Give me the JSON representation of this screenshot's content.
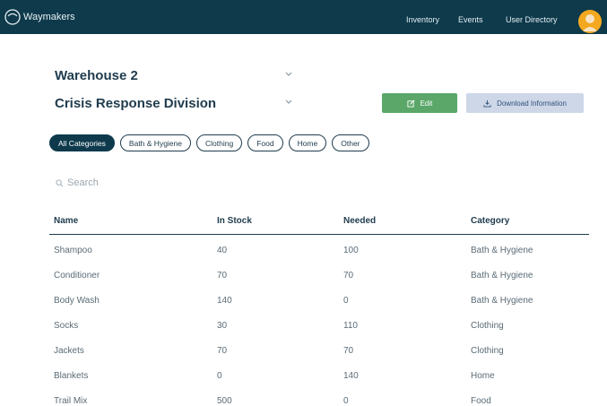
{
  "header": {
    "brand": "Waymakers",
    "nav": [
      "Inventory",
      "Events",
      "User Directory"
    ]
  },
  "selectors": {
    "warehouse": "Warehouse 2",
    "division": "Crisis Response Division"
  },
  "actions": {
    "edit_label": "Edit",
    "download_label": "Download Information"
  },
  "categories": [
    "All Categories",
    "Bath & Hygiene",
    "Clothing",
    "Food",
    "Home",
    "Other"
  ],
  "search": {
    "placeholder": "Search"
  },
  "table": {
    "columns": [
      "Name",
      "In Stock",
      "Needed",
      "Category"
    ],
    "rows": [
      [
        "Shampoo",
        "40",
        "100",
        "Bath & Hygiene"
      ],
      [
        "Conditioner",
        "70",
        "70",
        "Bath & Hygiene"
      ],
      [
        "Body Wash",
        "140",
        "0",
        "Bath & Hygiene"
      ],
      [
        "Socks",
        "30",
        "110",
        "Clothing"
      ],
      [
        "Jackets",
        "70",
        "70",
        "Clothing"
      ],
      [
        "Blankets",
        "0",
        "140",
        "Home"
      ],
      [
        "Trail Mix",
        "500",
        "0",
        "Food"
      ]
    ]
  },
  "colors": {
    "nav_bg": "#0e3a4c",
    "edit_button": "#5aa769",
    "download_button": "#cdd7e8",
    "avatar": "#f3a81f"
  }
}
